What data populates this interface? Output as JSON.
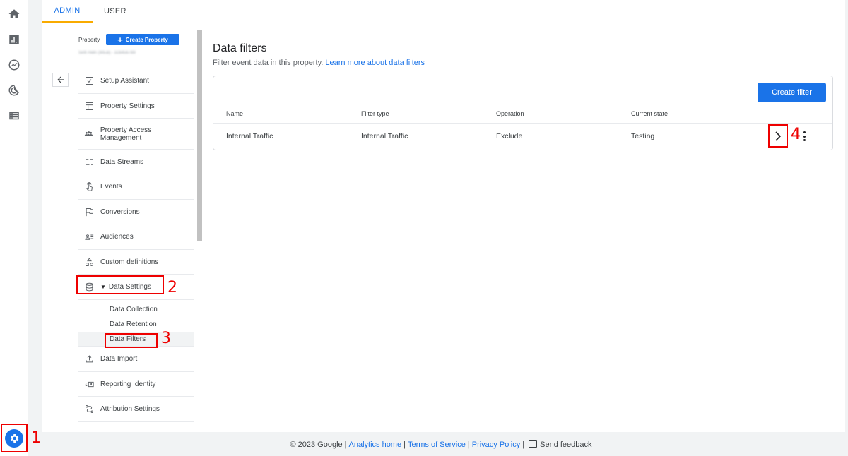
{
  "rail": {
    "icons": [
      "home-icon",
      "reports-icon",
      "explore-icon",
      "advertising-icon",
      "configure-icon"
    ],
    "admin_icon": "gear-icon"
  },
  "tabs": {
    "admin": "ADMIN",
    "user": "USER"
  },
  "property": {
    "label": "Property",
    "create_button": "Create Property",
    "id_text": "Sinh Hiển (WEB) - 328456789",
    "back_icon": "arrow-left-icon"
  },
  "nav": {
    "setup_assistant": "Setup Assistant",
    "property_settings": "Property Settings",
    "property_access": "Property Access Management",
    "data_streams": "Data Streams",
    "events": "Events",
    "conversions": "Conversions",
    "audiences": "Audiences",
    "custom_definitions": "Custom definitions",
    "data_settings": "Data Settings",
    "sub": {
      "data_collection": "Data Collection",
      "data_retention": "Data Retention",
      "data_filters": "Data Filters"
    },
    "data_import": "Data Import",
    "reporting_identity": "Reporting Identity",
    "attribution_settings": "Attribution Settings"
  },
  "content": {
    "title": "Data filters",
    "subtitle": "Filter event data in this property.",
    "learn_more": "Learn more about data filters",
    "create_filter": "Create filter",
    "columns": [
      "Name",
      "Filter type",
      "Operation",
      "Current state"
    ],
    "rows": [
      {
        "name": "Internal Traffic",
        "filter_type": "Internal Traffic",
        "operation": "Exclude",
        "state": "Testing"
      }
    ]
  },
  "annotations": {
    "one": "1",
    "two": "2",
    "three": "3",
    "four": "4"
  },
  "footer": {
    "copyright": "© 2023 Google",
    "analytics_home": "Analytics home",
    "terms": "Terms of Service",
    "privacy": "Privacy Policy",
    "feedback": "Send feedback"
  },
  "colors": {
    "accent": "#1a73e8",
    "annotation": "#e00000",
    "tab_indicator": "#f9ab00"
  }
}
